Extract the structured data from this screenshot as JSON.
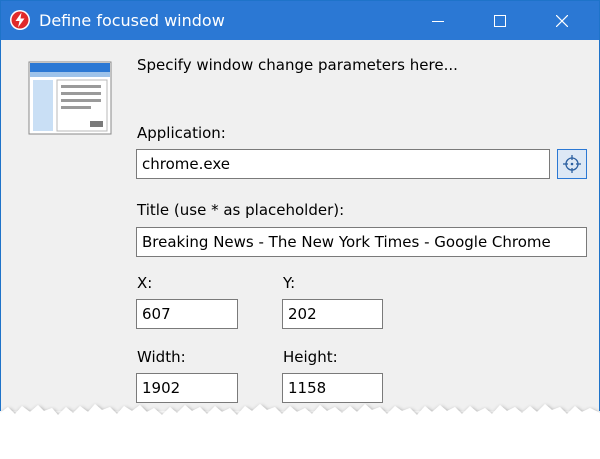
{
  "window": {
    "title": "Define focused window",
    "app_icon": "red-lightning-circle-icon",
    "controls": [
      "minimize-icon",
      "maximize-icon",
      "close-icon"
    ]
  },
  "dialog": {
    "icon": "window-layout-icon",
    "intro": "Specify window change parameters here...",
    "application": {
      "label": "Application:",
      "value": "chrome.exe",
      "picker_icon": "crosshair-icon"
    },
    "title_field": {
      "label": "Title (use * as placeholder):",
      "value": "Breaking News - The New York Times - Google Chrome"
    },
    "x": {
      "label": "X:",
      "value": "607"
    },
    "y": {
      "label": "Y:",
      "value": "202"
    },
    "width": {
      "label": "Width:",
      "value": "1902"
    },
    "height": {
      "label": "Height:",
      "value": "1158"
    }
  },
  "colors": {
    "titlebar": "#2b78d4",
    "window_bg": "#f0f0f0",
    "accent": "#2b78d4",
    "app_icon_red": "#e02a2a"
  }
}
